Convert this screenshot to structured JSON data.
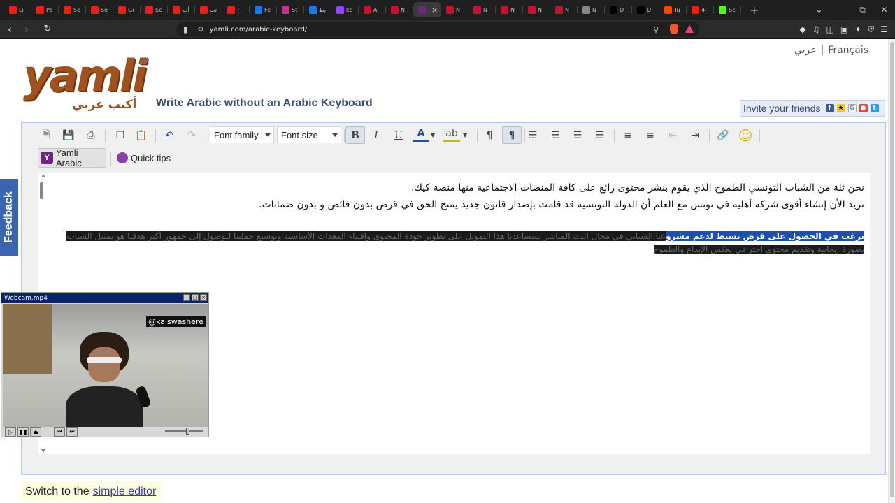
{
  "browser": {
    "tabs": [
      {
        "fav": "yt",
        "color": "#e62117",
        "title": "Li"
      },
      {
        "fav": "yt",
        "color": "#e62117",
        "title": "Pc"
      },
      {
        "fav": "yt",
        "color": "#e62117",
        "title": "Se"
      },
      {
        "fav": "yt",
        "color": "#e62117",
        "title": "Se"
      },
      {
        "fav": "yt",
        "color": "#e62117",
        "title": "Gi"
      },
      {
        "fav": "yt",
        "color": "#e62117",
        "title": "Sc"
      },
      {
        "fav": "yt",
        "color": "#e62117",
        "title": "أب"
      },
      {
        "fav": "yt",
        "color": "#e62117",
        "title": "تب"
      },
      {
        "fav": "yt",
        "color": "#e62117",
        "title": "خ"
      },
      {
        "fav": "fb",
        "color": "#1877f2",
        "title": "Fe"
      },
      {
        "fav": "ig",
        "color": "#c13584",
        "title": "St"
      },
      {
        "fav": "fb",
        "color": "#1877f2",
        "title": "يط"
      },
      {
        "fav": "tw",
        "color": "#9146ff",
        "title": "kc"
      },
      {
        "fav": "nl",
        "color": "#c4122f",
        "title": "À"
      },
      {
        "fav": "nl",
        "color": "#c4122f",
        "title": "N"
      },
      {
        "fav": "ym",
        "color": "#6a2a7a",
        "title": ""
      },
      {
        "fav": "nl",
        "color": "#c4122f",
        "title": "N"
      },
      {
        "fav": "nl",
        "color": "#c4122f",
        "title": "N"
      },
      {
        "fav": "nl",
        "color": "#c4122f",
        "title": "N"
      },
      {
        "fav": "nl",
        "color": "#c4122f",
        "title": "N"
      },
      {
        "fav": "nl",
        "color": "#c4122f",
        "title": "N"
      },
      {
        "fav": "sh",
        "color": "#888888",
        "title": "N"
      },
      {
        "fav": "x",
        "color": "#000000",
        "title": "D"
      },
      {
        "fav": "x",
        "color": "#000000",
        "title": "D"
      },
      {
        "fav": "rd",
        "color": "#ff4500",
        "title": "Tu"
      },
      {
        "fav": "yt",
        "color": "#e62117",
        "title": "4("
      },
      {
        "fav": "kk",
        "color": "#53fc18",
        "title": "Sc"
      }
    ],
    "active_tab_index": 15,
    "url": "yamli.com/arabic-keyboard/"
  },
  "page": {
    "lang_arabic": "عربي",
    "lang_sep": "|",
    "lang_french": "Français",
    "logo_word": "yamli",
    "logo_tm": "TM",
    "logo_arabic": "أكتب عربي",
    "tagline": "Write Arabic without an Arabic Keyboard",
    "invite_label": "Invite your friends",
    "feedback": "Feedback",
    "simple_prefix": "Switch to the",
    "simple_link": "simple editor"
  },
  "toolbar": {
    "font_family": "Font family",
    "font_size": "Font size",
    "bold": "B",
    "italic": "I",
    "underline": "U",
    "font_color": "A",
    "yamli_btn": "Yamli Arabic",
    "quick_tips": "Quick tips"
  },
  "editor": {
    "line1": "نحن ثلة من الشباب التونسي الطموح الذي يقوم بنشر محتوى رائع على كافة المنصات الاجتماعية منها منصة كيك.",
    "line2": "نريد الأن إنشاء أقوى شركة أهلية في تونس مع العلم أن الدولة التونسية قد قامت بإصدار قانون جديد يمنح الحق في قرض بدون فائض و بدون ضمانات.",
    "hl_selected": "نرغب في الحصول على قرض بسيط لدعم مشرو",
    "hl_rest1": "عنا الشبابي في مجال البث المباشر سيساعدنا هذا التمويل على تطوير جودة المحتوى واقتناء المعدات الأساسية وتوسيع حملتنا للوصول إلى جمهور أكبر هدفنا هو تمثيل الشباب",
    "hl_line2": "بصورة إيجابية وتقديم محتوى احترافي يعكس الإبداع والطموح"
  },
  "webcam": {
    "title": "Webcam.mp4",
    "handle": "@kaiswashere"
  }
}
